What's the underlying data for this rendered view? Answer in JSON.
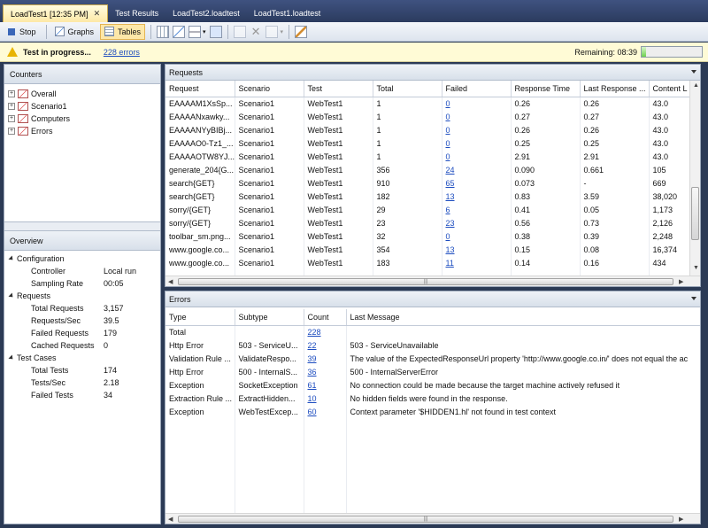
{
  "tabs": [
    {
      "label": "LoadTest1 [12:35 PM]",
      "active": true,
      "closable": true
    },
    {
      "label": "Test Results"
    },
    {
      "label": "LoadTest2.loadtest"
    },
    {
      "label": "LoadTest1.loadtest"
    }
  ],
  "toolbar": {
    "stop": "Stop",
    "graphs": "Graphs",
    "tables": "Tables"
  },
  "status": {
    "message": "Test in progress...",
    "errors_link": "228 errors",
    "remaining_label": "Remaining:",
    "remaining_time": "08:39",
    "progress": 0.07
  },
  "counters": {
    "title": "Counters",
    "items": [
      "Overall",
      "Scenario1",
      "Computers",
      "Errors"
    ]
  },
  "overview": {
    "title": "Overview",
    "rows": [
      {
        "type": "group",
        "label": "Configuration"
      },
      {
        "type": "kv",
        "label": "Controller",
        "value": "Local run"
      },
      {
        "type": "kv",
        "label": "Sampling Rate",
        "value": "00:05"
      },
      {
        "type": "group",
        "label": "Requests"
      },
      {
        "type": "kv",
        "label": "Total Requests",
        "value": "3,157"
      },
      {
        "type": "kv",
        "label": "Requests/Sec",
        "value": "39.5"
      },
      {
        "type": "kv",
        "label": "Failed Requests",
        "value": "179"
      },
      {
        "type": "kv",
        "label": "Cached Requests",
        "value": "0"
      },
      {
        "type": "group",
        "label": "Test Cases"
      },
      {
        "type": "kv",
        "label": "Total Tests",
        "value": "174"
      },
      {
        "type": "kv",
        "label": "Tests/Sec",
        "value": "2.18"
      },
      {
        "type": "kv",
        "label": "Failed Tests",
        "value": "34"
      }
    ]
  },
  "requests": {
    "title": "Requests",
    "columns": [
      "Request",
      "Scenario",
      "Test",
      "Total",
      "Failed",
      "Response Time",
      "Last Response ...",
      "Content L"
    ],
    "rows": [
      [
        "EAAAAM1XsSp...",
        "Scenario1",
        "WebTest1",
        "1",
        "0",
        "0.26",
        "0.26",
        "43.0"
      ],
      [
        "EAAAANxawky...",
        "Scenario1",
        "WebTest1",
        "1",
        "0",
        "0.27",
        "0.27",
        "43.0"
      ],
      [
        "EAAAANYyBIBj...",
        "Scenario1",
        "WebTest1",
        "1",
        "0",
        "0.26",
        "0.26",
        "43.0"
      ],
      [
        "EAAAAO0-Tz1_...",
        "Scenario1",
        "WebTest1",
        "1",
        "0",
        "0.25",
        "0.25",
        "43.0"
      ],
      [
        "EAAAAOTW8YJ...",
        "Scenario1",
        "WebTest1",
        "1",
        "0",
        "2.91",
        "2.91",
        "43.0"
      ],
      [
        "generate_204{G...",
        "Scenario1",
        "WebTest1",
        "356",
        "24",
        "0.090",
        "0.661",
        "105"
      ],
      [
        "search{GET}",
        "Scenario1",
        "WebTest1",
        "910",
        "65",
        "0.073",
        "-",
        "669"
      ],
      [
        "search{GET}",
        "Scenario1",
        "WebTest1",
        "182",
        "13",
        "0.83",
        "3.59",
        "38,020"
      ],
      [
        "sorry/{GET}",
        "Scenario1",
        "WebTest1",
        "29",
        "6",
        "0.41",
        "0.05",
        "1,173"
      ],
      [
        "sorry/{GET}",
        "Scenario1",
        "WebTest1",
        "23",
        "23",
        "0.56",
        "0.73",
        "2,126"
      ],
      [
        "toolbar_sm.png...",
        "Scenario1",
        "WebTest1",
        "32",
        "0",
        "0.38",
        "0.39",
        "2,248"
      ],
      [
        "www.google.co...",
        "Scenario1",
        "WebTest1",
        "354",
        "13",
        "0.15",
        "0.08",
        "16,374"
      ],
      [
        "www.google.co...",
        "Scenario1",
        "WebTest1",
        "183",
        "11",
        "0.14",
        "0.16",
        "434"
      ]
    ]
  },
  "errors": {
    "title": "Errors",
    "columns": [
      "Type",
      "Subtype",
      "Count",
      "Last Message"
    ],
    "rows": [
      [
        "Total",
        "",
        "228",
        ""
      ],
      [
        "Http Error",
        "503 - ServiceU...",
        "22",
        "503 - ServiceUnavailable"
      ],
      [
        "Validation Rule ...",
        "ValidateRespo...",
        "39",
        "The value of the ExpectedResponseUrl property 'http://www.google.co.in/' does not equal the ac"
      ],
      [
        "Http Error",
        "500 - InternalS...",
        "36",
        "500 - InternalServerError"
      ],
      [
        "Exception",
        "SocketException",
        "61",
        "No connection could be made because the target machine actively refused it"
      ],
      [
        "Extraction Rule ...",
        "ExtractHidden...",
        "10",
        "No hidden fields were found in the response."
      ],
      [
        "Exception",
        "WebTestExcep...",
        "60",
        "Context parameter '$HIDDEN1.hl' not found in test context"
      ]
    ]
  }
}
